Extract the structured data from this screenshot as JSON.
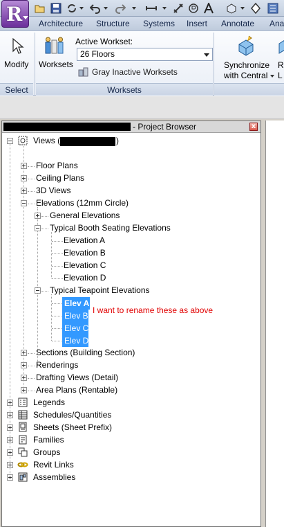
{
  "tabs": [
    "Architecture",
    "Structure",
    "Systems",
    "Insert",
    "Annotate",
    "Ana"
  ],
  "ribbon": {
    "select_panel": {
      "title": "Select",
      "modify_label": "Modify"
    },
    "worksets_panel": {
      "title": "Worksets",
      "worksets_label": "Worksets",
      "active_workset_label": "Active Workset:",
      "active_workset_value": "26 Floors",
      "gray_inactive_label": "Gray Inactive Worksets"
    },
    "sync": {
      "line1": "Synchronize",
      "line2": "with Central",
      "cut1": "R",
      "cut2": "L"
    }
  },
  "project_browser": {
    "title": "- Project Browser",
    "close_glyph": "x",
    "annotation": "I want to rename these as above",
    "tree": [
      {
        "label": "Views (",
        "suffix": ")"
      },
      {
        "label": "Floor Plans"
      },
      {
        "label": "Ceiling Plans"
      },
      {
        "label": "3D Views"
      },
      {
        "label": "Elevations (12mm Circle)"
      },
      {
        "label": "General Elevations"
      },
      {
        "label": "Typical Booth Seating Elevations"
      },
      {
        "label": "Elevation A"
      },
      {
        "label": "Elevation B"
      },
      {
        "label": "Elevation C"
      },
      {
        "label": "Elevation D"
      },
      {
        "label": "Typical Teapoint Elevations"
      },
      {
        "label": "Elev A"
      },
      {
        "label": "Elev B"
      },
      {
        "label": "Elev C"
      },
      {
        "label": "Elev D"
      },
      {
        "label": "Sections (Building Section)"
      },
      {
        "label": "Renderings"
      },
      {
        "label": "Drafting Views (Detail)"
      },
      {
        "label": "Area Plans (Rentable)"
      },
      {
        "label": "Legends"
      },
      {
        "label": "Schedules/Quantities"
      },
      {
        "label": "Sheets (Sheet Prefix)"
      },
      {
        "label": "Families"
      },
      {
        "label": "Groups"
      },
      {
        "label": "Revit Links"
      },
      {
        "label": "Assemblies"
      }
    ]
  },
  "colors": {
    "selection": "#3399ff",
    "annotation": "#e10000",
    "app_button": "#7b3fa8"
  }
}
